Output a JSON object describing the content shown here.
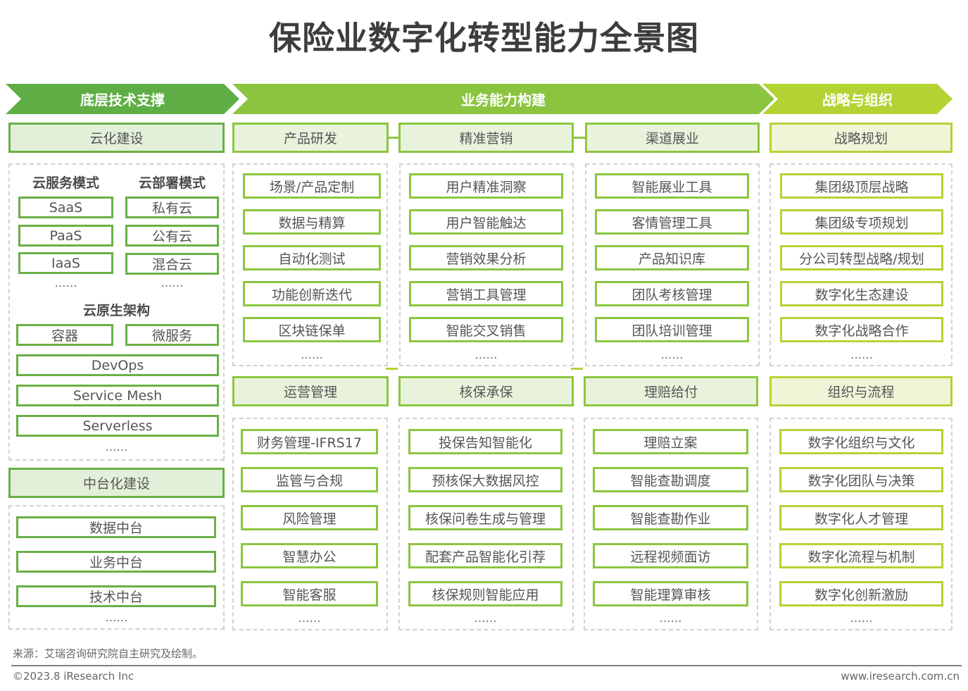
{
  "title": "保险业数字化转型能力全景图",
  "colors": {
    "banner_left": "#5fae45",
    "banner_mid": "#8bc53f",
    "banner_right": "#b3d335",
    "box_border_left": "#6aaf46",
    "box_border_mid": "#8cc63f",
    "box_border_right": "#b5d334"
  },
  "banners": {
    "left": "底层技术支撑",
    "mid": "业务能力构建",
    "right": "战略与组织"
  },
  "tech": {
    "cloud": {
      "label": "云化建设",
      "service_model_title": "云服务模式",
      "service_models": [
        "SaaS",
        "PaaS",
        "IaaS"
      ],
      "deploy_model_title": "云部署模式",
      "deploy_models": [
        "私有云",
        "公有云",
        "混合云"
      ],
      "native_title": "云原生架构",
      "native_pair": [
        "容器",
        "微服务"
      ],
      "native_items": [
        "DevOps",
        "Service Mesh",
        "Serverless"
      ],
      "more": "……"
    },
    "middle_platform": {
      "label": "中台化建设",
      "items": [
        "数据中台",
        "业务中台",
        "技术中台"
      ],
      "more": "……"
    }
  },
  "business": {
    "top": [
      {
        "label": "产品研发",
        "items": [
          "场景/产品定制",
          "数据与精算",
          "自动化测试",
          "功能创新迭代",
          "区块链保单"
        ],
        "more": "……"
      },
      {
        "label": "精准营销",
        "items": [
          "用户精准洞察",
          "用户智能触达",
          "营销效果分析",
          "营销工具管理",
          "智能交叉销售"
        ],
        "more": "……"
      },
      {
        "label": "渠道展业",
        "items": [
          "智能展业工具",
          "客情管理工具",
          "产品知识库",
          "团队考核管理",
          "团队培训管理"
        ],
        "more": "……"
      }
    ],
    "bottom": [
      {
        "label": "运营管理",
        "items": [
          "财务管理-IFRS17",
          "监管与合规",
          "风险管理",
          "智慧办公",
          "智能客服"
        ],
        "more": "……"
      },
      {
        "label": "核保承保",
        "items": [
          "投保告知智能化",
          "预核保大数据风控",
          "核保问卷生成与管理",
          "配套产品智能化引荐",
          "核保规则智能应用"
        ],
        "more": "……"
      },
      {
        "label": "理赔给付",
        "items": [
          "理赔立案",
          "智能查勘调度",
          "智能查勘作业",
          "远程视频面访",
          "智能理算审核"
        ],
        "more": "……"
      }
    ]
  },
  "strategy": {
    "planning": {
      "label": "战略规划",
      "items": [
        "集团级顶层战略",
        "集团级专项规划",
        "分公司转型战略/规划",
        "数字化生态建设",
        "数字化战略合作"
      ],
      "more": "……"
    },
    "organization": {
      "label": "组织与流程",
      "items": [
        "数字化组织与文化",
        "数字化团队与决策",
        "数字化人才管理",
        "数字化流程与机制",
        "数字化创新激励"
      ],
      "more": "……"
    }
  },
  "footer": {
    "source": "来源：艾瑞咨询研究院自主研究及绘制。",
    "copyright": "©2023.8 iResearch Inc",
    "website": "www.iresearch.com.cn"
  }
}
